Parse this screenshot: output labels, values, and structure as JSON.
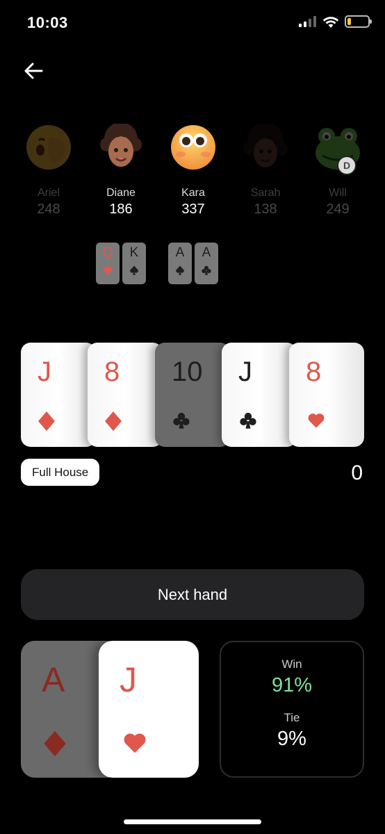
{
  "status": {
    "time": "10:03",
    "battery_level": 0.18
  },
  "nav": {
    "back_icon": "arrow-left-icon"
  },
  "players": [
    {
      "name": "Ariel",
      "stack": "248",
      "active": false,
      "dealer": false,
      "avatar": "face-with-hand-over-mouth"
    },
    {
      "name": "Diane",
      "stack": "186",
      "active": true,
      "dealer": false,
      "avatar": "curly-hair-person"
    },
    {
      "name": "Kara",
      "stack": "337",
      "active": true,
      "dealer": false,
      "avatar": "flushed-face"
    },
    {
      "name": "Sarah",
      "stack": "138",
      "active": false,
      "dealer": false,
      "avatar": "curly-hair-person-dark"
    },
    {
      "name": "Will",
      "stack": "249",
      "active": false,
      "dealer": true,
      "avatar": "frog-face"
    }
  ],
  "dealer_badge": "D",
  "hole_cards": {
    "diane": [
      {
        "rank": "Q",
        "suit": "hearts"
      },
      {
        "rank": "K",
        "suit": "spades"
      }
    ],
    "kara": [
      {
        "rank": "A",
        "suit": "spades"
      },
      {
        "rank": "A",
        "suit": "clubs"
      }
    ]
  },
  "board": [
    {
      "rank": "J",
      "suit": "diamonds"
    },
    {
      "rank": "8",
      "suit": "diamonds"
    },
    {
      "rank": "10",
      "suit": "clubs"
    },
    {
      "rank": "J",
      "suit": "clubs"
    },
    {
      "rank": "8",
      "suit": "hearts"
    }
  ],
  "hand_name": "Full House",
  "pot": "0",
  "next_hand_label": "Next hand",
  "my_cards": [
    {
      "rank": "A",
      "suit": "diamonds"
    },
    {
      "rank": "J",
      "suit": "hearts"
    }
  ],
  "odds": {
    "win_label": "Win",
    "win_value": "91%",
    "tie_label": "Tie",
    "tie_value": "9%"
  },
  "colors": {
    "red_suit": "#e0574d",
    "win_green": "#7ee29a",
    "button_bg": "#242427"
  }
}
